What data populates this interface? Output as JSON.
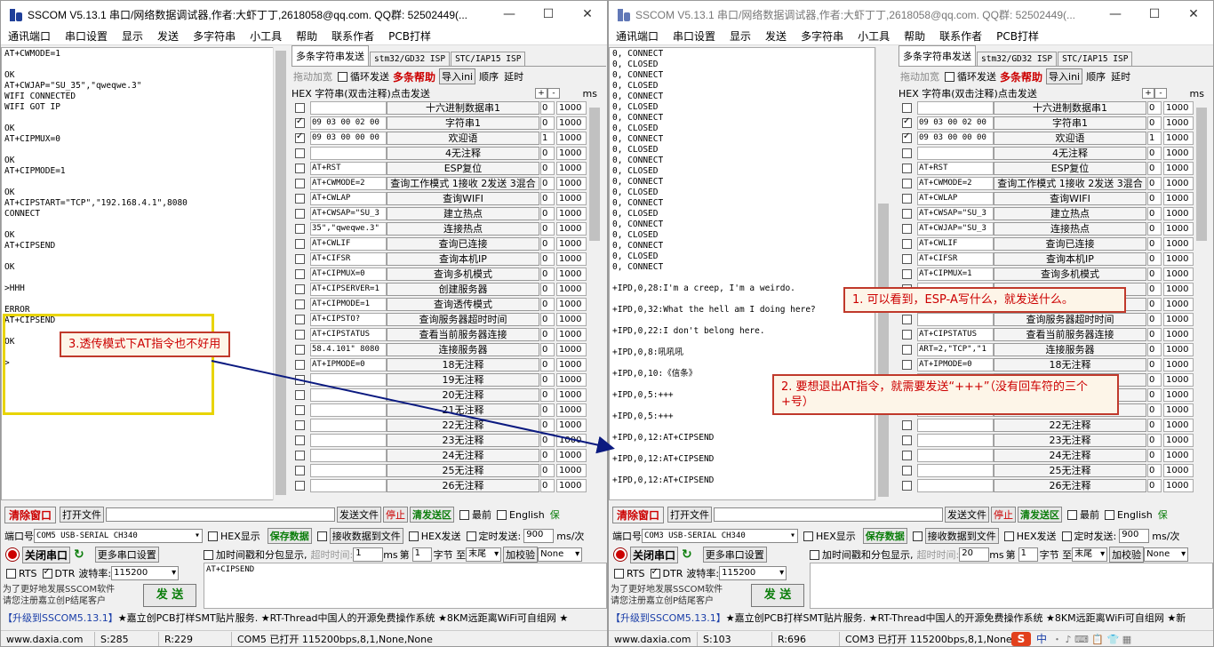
{
  "left": {
    "title": "SSCOM V5.13.1 串口/网络数据调试器,作者:大虾丁丁,2618058@qq.com. QQ群: 52502449(...",
    "rx_text": "AT+CWMODE=1\n\nOK\nAT+CWJAP=\"SU_35\",\"qweqwe.3\"\nWIFI CONNECTED\nWIFI GOT IP\n\nOK\nAT+CIPMUX=0\n\nOK\nAT+CIPMODE=1\n\nOK\nAT+CIPSTART=\"TCP\",\"192.168.4.1\",8080\nCONNECT\n\nOK\nAT+CIPSEND\n\nOK\n\n>HHH\n\nERROR\nAT+CIPSEND\n\nOK\n\n>",
    "rows": [
      {
        "checked": false,
        "str": "",
        "name": "十六进制数据串1",
        "order": "0",
        "delay": "1000"
      },
      {
        "checked": true,
        "str": "09 03 00 02 00",
        "name": "字符串1",
        "order": "0",
        "delay": "1000"
      },
      {
        "checked": true,
        "str": "09 03 00 00 00",
        "name": "欢迎语",
        "order": "1",
        "delay": "1000"
      },
      {
        "checked": false,
        "str": "",
        "name": "4无注释",
        "order": "0",
        "delay": "1000"
      },
      {
        "checked": false,
        "str": "AT+RST",
        "name": "ESP复位",
        "order": "0",
        "delay": "1000"
      },
      {
        "checked": false,
        "str": "AT+CWMODE=2",
        "name": "查询工作模式 1接收 2发送 3混合",
        "order": "0",
        "delay": "1000"
      },
      {
        "checked": false,
        "str": "AT+CWLAP",
        "name": "查询WIFI",
        "order": "0",
        "delay": "1000"
      },
      {
        "checked": false,
        "str": "AT+CWSAP=\"SU_3",
        "name": "建立热点",
        "order": "0",
        "delay": "1000"
      },
      {
        "checked": false,
        "str": "35\",\"qweqwe.3\"",
        "name": "连接热点",
        "order": "0",
        "delay": "1000"
      },
      {
        "checked": false,
        "str": "AT+CWLIF",
        "name": "查询已连接",
        "order": "0",
        "delay": "1000"
      },
      {
        "checked": false,
        "str": "AT+CIFSR",
        "name": "查询本机IP",
        "order": "0",
        "delay": "1000"
      },
      {
        "checked": false,
        "str": "AT+CIPMUX=0",
        "name": "查询多机模式",
        "order": "0",
        "delay": "1000"
      },
      {
        "checked": false,
        "str": "AT+CIPSERVER=1",
        "name": "创建服务器",
        "order": "0",
        "delay": "1000"
      },
      {
        "checked": false,
        "str": "AT+CIPMODE=1",
        "name": "查询透传模式",
        "order": "0",
        "delay": "1000"
      },
      {
        "checked": false,
        "str": "AT+CIPSTO?",
        "name": "查询服务器超时时间",
        "order": "0",
        "delay": "1000"
      },
      {
        "checked": false,
        "str": "AT+CIPSTATUS",
        "name": "查看当前服务器连接",
        "order": "0",
        "delay": "1000"
      },
      {
        "checked": false,
        "str": "58.4.101\" 8080",
        "name": "连接服务器",
        "order": "0",
        "delay": "1000"
      },
      {
        "checked": false,
        "str": "AT+IPMODE=0",
        "name": "18无注释",
        "order": "0",
        "delay": "1000"
      },
      {
        "checked": false,
        "str": "",
        "name": "19无注释",
        "order": "0",
        "delay": "1000"
      },
      {
        "checked": false,
        "str": "",
        "name": "20无注释",
        "order": "0",
        "delay": "1000"
      },
      {
        "checked": false,
        "str": "",
        "name": "21无注释",
        "order": "0",
        "delay": "1000"
      },
      {
        "checked": false,
        "str": "",
        "name": "22无注释",
        "order": "0",
        "delay": "1000"
      },
      {
        "checked": false,
        "str": "",
        "name": "23无注释",
        "order": "0",
        "delay": "1000"
      },
      {
        "checked": false,
        "str": "",
        "name": "24无注释",
        "order": "0",
        "delay": "1000"
      },
      {
        "checked": false,
        "str": "",
        "name": "25无注释",
        "order": "0",
        "delay": "1000"
      },
      {
        "checked": false,
        "str": "",
        "name": "26无注释",
        "order": "0",
        "delay": "1000"
      }
    ],
    "port": "COM5 USB-SERIAL CH340",
    "baud": "115200",
    "time_val": "1",
    "tx_text": "AT+CIPSEND",
    "status": {
      "s": "S:285",
      "r": "R:229",
      "conn": "COM5 已打开  115200bps,8,1,None,None"
    }
  },
  "right": {
    "title": "SSCOM V5.13.1 串口/网络数据调试器,作者:大虾丁丁,2618058@qq.com. QQ群: 52502449(...",
    "rx_text": "0, CONNECT\n0, CLOSED\n0, CONNECT\n0, CLOSED\n0, CONNECT\n0, CLOSED\n0, CONNECT\n0, CLOSED\n0, CONNECT\n0, CLOSED\n0, CONNECT\n0, CLOSED\n0, CONNECT\n0, CLOSED\n0, CONNECT\n0, CLOSED\n0, CONNECT\n0, CLOSED\n0, CONNECT\n0, CLOSED\n0, CONNECT\n\n+IPD,0,28:I'm a creep, I'm a weirdo.\n\n+IPD,0,32:What the hell am I doing here?\n\n+IPD,0,22:I don't belong here.\n\n+IPD,0,8:吼吼吼\n\n+IPD,0,10:《信条》\n\n+IPD,0,5:+++\n\n+IPD,0,5:+++\n\n+IPD,0,12:AT+CIPSEND\n\n+IPD,0,12:AT+CIPSEND\n\n+IPD,0,12:AT+CIPSEND",
    "rows": [
      {
        "checked": false,
        "str": "",
        "name": "十六进制数据串1",
        "order": "0",
        "delay": "1000"
      },
      {
        "checked": true,
        "str": "09 03 00 02 00",
        "name": "字符串1",
        "order": "0",
        "delay": "1000"
      },
      {
        "checked": true,
        "str": "09 03 00 00 00",
        "name": "欢迎语",
        "order": "1",
        "delay": "1000"
      },
      {
        "checked": false,
        "str": "",
        "name": "4无注释",
        "order": "0",
        "delay": "1000"
      },
      {
        "checked": false,
        "str": "AT+RST",
        "name": "ESP复位",
        "order": "0",
        "delay": "1000"
      },
      {
        "checked": false,
        "str": "AT+CWMODE=2",
        "name": "查询工作模式 1接收 2发送 3混合",
        "order": "0",
        "delay": "1000"
      },
      {
        "checked": false,
        "str": "AT+CWLAP",
        "name": "查询WIFI",
        "order": "0",
        "delay": "1000"
      },
      {
        "checked": false,
        "str": "AT+CWSAP=\"SU_3",
        "name": "建立热点",
        "order": "0",
        "delay": "1000"
      },
      {
        "checked": false,
        "str": "AT+CWJAP=\"SU_3",
        "name": "连接热点",
        "order": "0",
        "delay": "1000"
      },
      {
        "checked": false,
        "str": "AT+CWLIF",
        "name": "查询已连接",
        "order": "0",
        "delay": "1000"
      },
      {
        "checked": false,
        "str": "AT+CIFSR",
        "name": "查询本机IP",
        "order": "0",
        "delay": "1000"
      },
      {
        "checked": false,
        "str": "AT+CIPMUX=1",
        "name": "查询多机模式",
        "order": "0",
        "delay": "1000"
      },
      {
        "checked": false,
        "str": "",
        "name": "",
        "order": "0",
        "delay": "1000"
      },
      {
        "checked": false,
        "str": "",
        "name": "",
        "order": "0",
        "delay": "1000"
      },
      {
        "checked": false,
        "str": "",
        "name": "查询服务器超时时间",
        "order": "0",
        "delay": "1000"
      },
      {
        "checked": false,
        "str": "AT+CIPSTATUS",
        "name": "查看当前服务器连接",
        "order": "0",
        "delay": "1000"
      },
      {
        "checked": false,
        "str": "ART=2,\"TCP\",\"1",
        "name": "连接服务器",
        "order": "0",
        "delay": "1000"
      },
      {
        "checked": false,
        "str": "AT+IPMODE=0",
        "name": "18无注释",
        "order": "0",
        "delay": "1000"
      },
      {
        "checked": false,
        "str": "",
        "name": "",
        "order": "0",
        "delay": "1000"
      },
      {
        "checked": false,
        "str": "",
        "name": "",
        "order": "0",
        "delay": "1000"
      },
      {
        "checked": false,
        "str": "",
        "name": "",
        "order": "0",
        "delay": "1000"
      },
      {
        "checked": false,
        "str": "",
        "name": "22无注释",
        "order": "0",
        "delay": "1000"
      },
      {
        "checked": false,
        "str": "",
        "name": "23无注释",
        "order": "0",
        "delay": "1000"
      },
      {
        "checked": false,
        "str": "",
        "name": "24无注释",
        "order": "0",
        "delay": "1000"
      },
      {
        "checked": false,
        "str": "",
        "name": "25无注释",
        "order": "0",
        "delay": "1000"
      },
      {
        "checked": false,
        "str": "",
        "name": "26无注释",
        "order": "0",
        "delay": "1000"
      }
    ],
    "port": "COM3 USB-SERIAL CH340",
    "baud": "115200",
    "time_val": "20",
    "tx_text": "",
    "status": {
      "s": "S:103",
      "r": "R:696",
      "conn": "COM3 已打开  115200bps,8,1,None"
    }
  },
  "labels": {
    "menu": [
      "通讯端口",
      "串口设置",
      "显示",
      "发送",
      "多字符串",
      "小工具",
      "帮助",
      "联系作者",
      "PCB打样"
    ],
    "tab_multi": "多条字符串发送",
    "tab_isp1": "stm32/GD32 ISP",
    "tab_isp2": "STC/IAP15 ISP",
    "drag": "拖动加宽",
    "loop": "循环发送",
    "multi_help": "多条帮助",
    "import": "导入ini",
    "order": "顺序",
    "delay": "延时",
    "hex_header": "HEX  字符串(双击注释)点击发送",
    "ms": "ms",
    "plus": "+",
    "minus": "-",
    "clear": "清除窗口",
    "open_file": "打开文件",
    "send_file": "发送文件",
    "stop": "停止",
    "clear_send": "清发送区",
    "latest": "最前",
    "english": "English",
    "save_params": "保",
    "port_label": "端口号",
    "hex_show": "HEX显示",
    "save_data": "保存数据",
    "recv_file": "接收数据到文件",
    "hex_send": "HEX发送",
    "timed_send": "定时发送:",
    "timed_val": "900",
    "ms_per": "ms/次",
    "close_port": "关闭串口",
    "more_settings": "更多串口设置",
    "timestamp": "加时间戳和分包显示,",
    "timeout": "超时时间:",
    "ms2": "ms",
    "nth": "第",
    "nth_val": "1",
    "byte_to": "字节 至",
    "tail": "末尾",
    "checksum": "加校验",
    "none": "None",
    "rts": "RTS",
    "dtr": "DTR",
    "baud_label": "波特率:",
    "promo1": "为了更好地发展SSCOM软件",
    "promo2": "请您注册嘉立创P结尾客户",
    "send": "发 送",
    "ads_l1": "【升级到SSCOM5.13.1】",
    "ads_l2": "★嘉立创PCB打样SMT贴片服务. ★RT-Thread中国人的开源免费操作系统 ★8KM远距离WiFi可自组网 ★",
    "ads_r2": "★嘉立创PCB打样SMT贴片服务. ★RT-Thread中国人的开源免费操作系统 ★8KM远距离WiFi可自组网 ★新",
    "site": "www.daxia.com",
    "min": "—",
    "max": "☐",
    "close": "✕"
  },
  "annotations": {
    "a1": "1. 可以看到，ESP-A写什么，就发送什么。",
    "a2": "2. 要想退出AT指令，就需要发送“+++”（没有回车符的三个+号）",
    "a3": "3.透传模式下AT指令也不好用"
  },
  "taskbar": {
    "ime": "中",
    "items": "・ ♪ ⌨ 📋 👕 ▦"
  }
}
